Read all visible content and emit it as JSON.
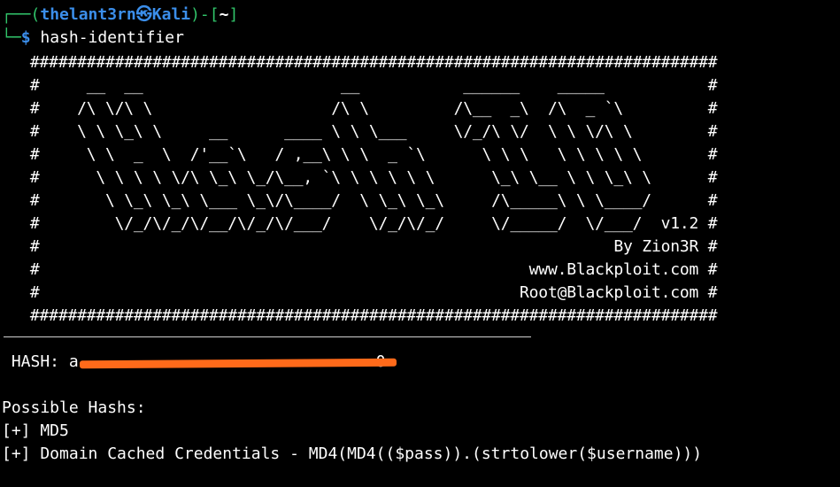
{
  "prompt": {
    "frame_top": "┌──(",
    "user_host": "thelant3rn㉿Kali",
    "frame_mid": ")-[",
    "cwd": "~",
    "frame_end": "]",
    "frame_bottom": "└─",
    "dollar": "$",
    "command": "hash-identifier"
  },
  "banner": {
    "text": "   #########################################################################\n   #     __  __                     __           ______    _____           #\n   #    /\\ \\/\\ \\                   /\\ \\         /\\__  _\\  /\\  _ `\\         #\n   #    \\ \\ \\_\\ \\     __      ____ \\ \\ \\___     \\/_/\\ \\/  \\ \\ \\/\\ \\        #\n   #     \\ \\  _  \\  /'__`\\   / ,__\\ \\ \\  _ `\\      \\ \\ \\   \\ \\ \\ \\ \\       #\n   #      \\ \\ \\ \\ \\/\\ \\_\\ \\_/\\__, `\\ \\ \\ \\ \\ \\      \\_\\ \\__ \\ \\ \\_\\ \\      #\n   #       \\ \\_\\ \\_\\ \\___ \\_\\/\\____/  \\ \\_\\ \\_\\     /\\_____\\ \\ \\____/      #\n   #        \\/_/\\/_/\\/__/\\/_/\\/___/    \\/_/\\/_/     \\/_____/  \\/___/  v1.2 #\n   #                                                             By Zion3R #\n   #                                                    www.Blackploit.com #\n   #                                                   Root@Blackploit.com #\n   #########################################################################"
  },
  "hash": {
    "label": " HASH: ",
    "value_prefix": "a",
    "value_suffix": "0"
  },
  "results": {
    "heading": "Possible Hashs:",
    "items": [
      "[+] MD5",
      "[+] Domain Cached Credentials - MD4(MD4(($pass)).(strtolower($username)))"
    ]
  },
  "colors": {
    "background": "#000000",
    "prompt_blue": "#3b8eea",
    "frame_green": "#31c46a",
    "redaction": "#ff6a1a"
  }
}
